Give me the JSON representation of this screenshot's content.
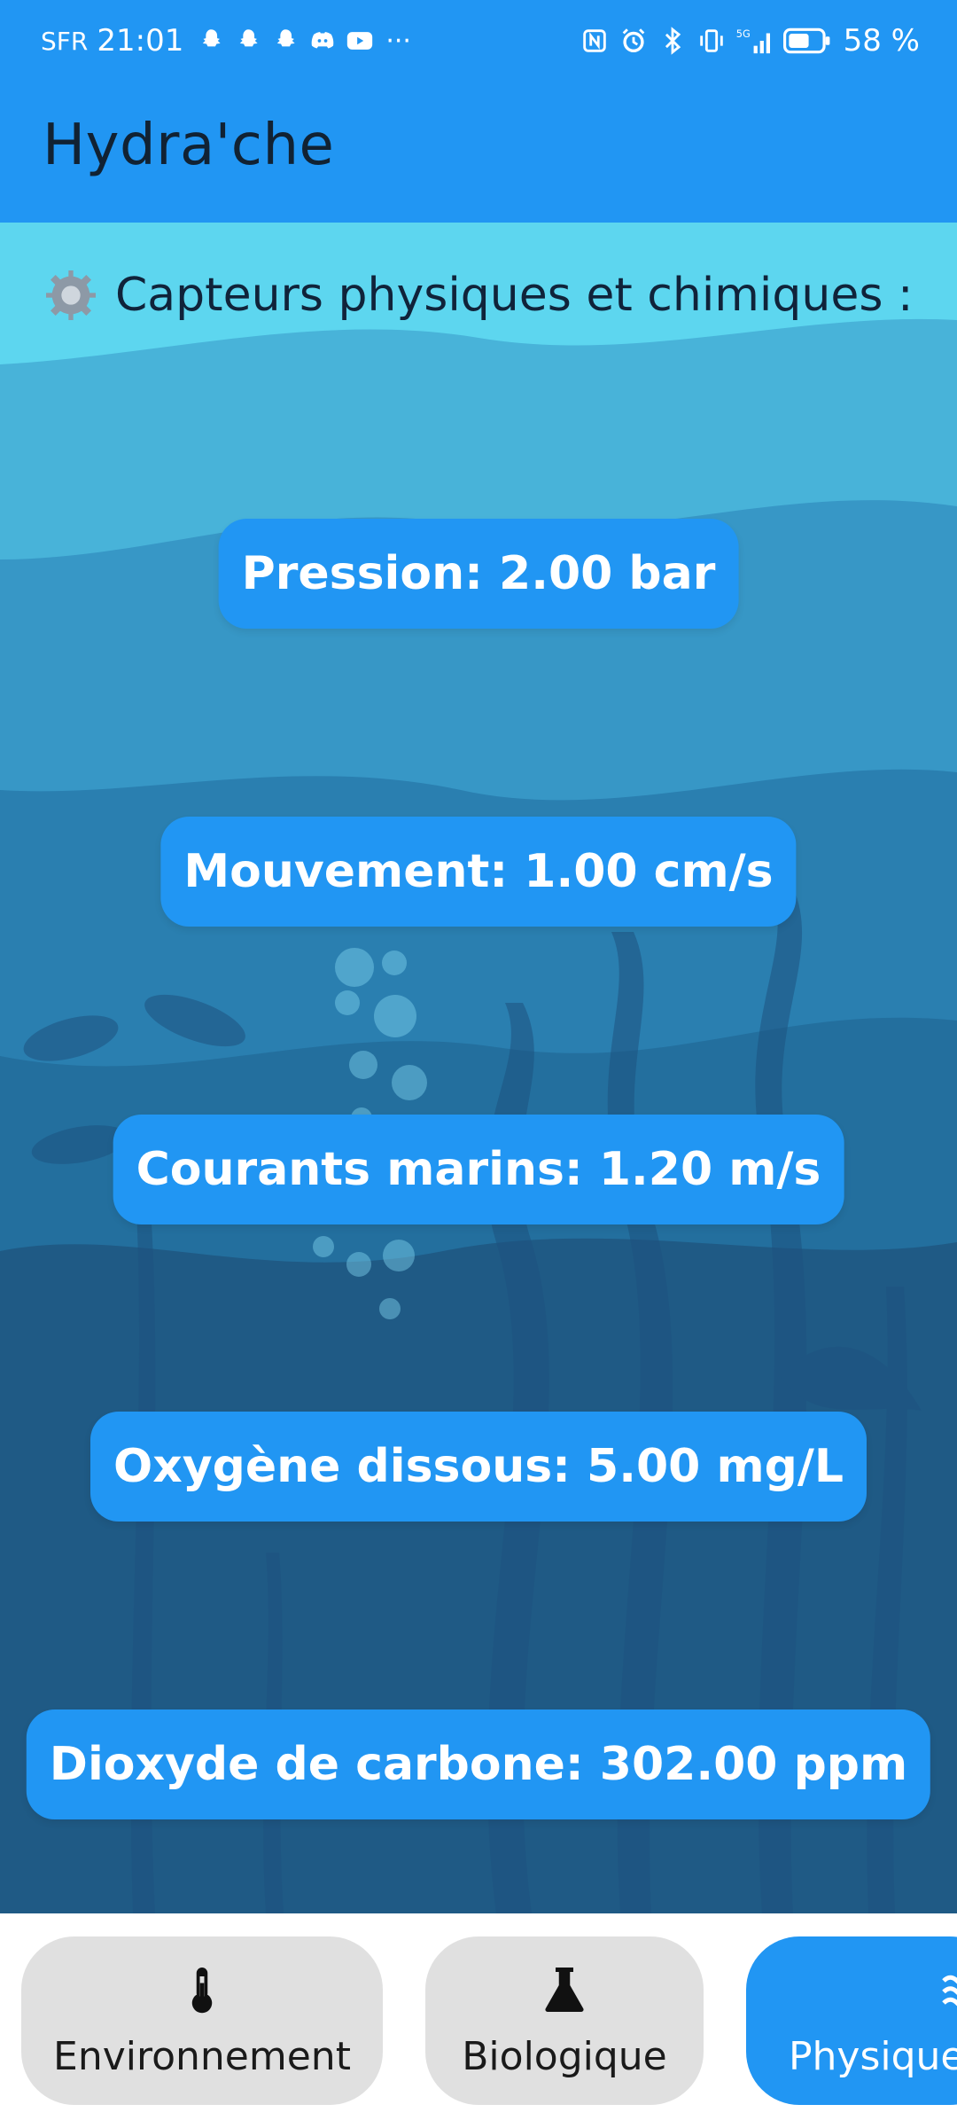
{
  "status_bar": {
    "carrier": "SFR",
    "time": "21:01",
    "battery": "58 %",
    "left_icons": [
      "snapchat-icon",
      "snapchat-icon",
      "snapchat-icon",
      "discord-icon",
      "youtube-icon",
      "more-dots-icon"
    ],
    "right_icons": [
      "nfc-icon",
      "alarm-icon",
      "bluetooth-icon",
      "vibrate-icon",
      "signal-5g-icon",
      "battery-icon"
    ],
    "more": "···"
  },
  "app_bar": {
    "title": "Hydra'che"
  },
  "section": {
    "icon": "gear-icon",
    "heading": "Capteurs physiques et chimiques :"
  },
  "sensors": [
    {
      "label": "Pression: 2.00 bar"
    },
    {
      "label": "Mouvement: 1.00 cm/s"
    },
    {
      "label": "Courants marins: 1.20 m/s"
    },
    {
      "label": "Oxygène dissous: 5.00 mg/L"
    },
    {
      "label": "Dioxyde de carbone: 302.00 ppm"
    }
  ],
  "bottom_nav": {
    "items": [
      {
        "label": "Environnement",
        "icon": "thermometer-icon",
        "active": false
      },
      {
        "label": "Biologique",
        "icon": "flask-icon",
        "active": false
      },
      {
        "label": "Physique",
        "icon": "waves-icon",
        "active": true
      }
    ]
  },
  "colors": {
    "primary": "#2196f3",
    "water_top": "#5dd6ef",
    "water_bottom": "#1f5a85",
    "nav_inactive": "#e0e0e0"
  }
}
